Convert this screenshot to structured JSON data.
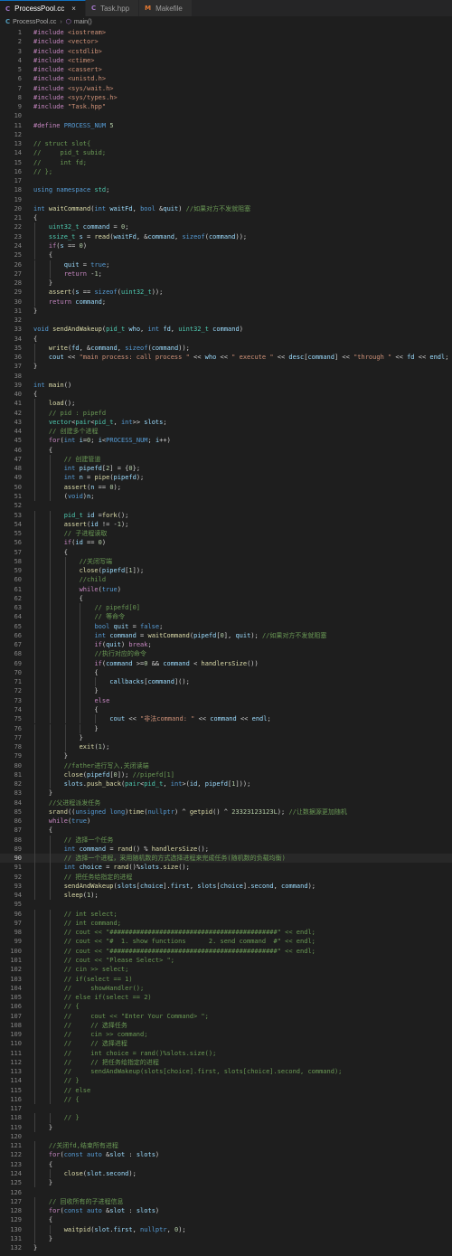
{
  "tabs": [
    {
      "label": "ProcessPool.cc",
      "icon": "C",
      "active": true
    },
    {
      "label": "Task.hpp",
      "icon": "C",
      "active": false
    },
    {
      "label": "Makefile",
      "icon": "M",
      "active": false
    }
  ],
  "breadcrumb": {
    "file": "ProcessPool.cc",
    "symbol": "main()"
  },
  "current_line": 90,
  "colors": {
    "accent": "#0e70c0",
    "background": "#1e1e1e",
    "keyword": "#569cd6",
    "string": "#ce9178",
    "comment": "#6a9955",
    "function": "#dcdcaa",
    "type": "#4ec9b0"
  },
  "code_lines": [
    "#include <iostream>",
    "#include <vector>",
    "#include <cstdlib>",
    "#include <ctime>",
    "#include <cassert>",
    "#include <unistd.h>",
    "#include <sys/wait.h>",
    "#include <sys/types.h>",
    "#include \"Task.hpp\"",
    "",
    "#define PROCESS_NUM 5",
    "",
    "// struct slot{",
    "//     pid_t subid;",
    "//     int fd;",
    "// };",
    "",
    "using namespace std;",
    "",
    "int waitCommand(int waitFd, bool &quit) //如果对方不发就阻塞",
    "{",
    "    uint32_t command = 0;",
    "    ssize_t s = read(waitFd, &command, sizeof(command));",
    "    if(s == 0)",
    "    {",
    "        quit = true;",
    "        return -1;",
    "    }",
    "    assert(s == sizeof(uint32_t));",
    "    return command;",
    "}",
    "",
    "void sendAndWakeup(pid_t who, int fd, uint32_t command)",
    "{",
    "    write(fd, &command, sizeof(command));",
    "    cout << \"main process: call process \" << who << \" execute \" << desc[command] << \"through \" << fd << endl;",
    "}",
    "",
    "int main()",
    "{",
    "    load();",
    "    // pid : pipefd",
    "    vector<pair<pid_t, int>> slots;",
    "    // 创建多个进程",
    "    for(int i=0; i<PROCESS_NUM; i++)",
    "    {",
    "        // 创建管道",
    "        int pipefd[2] = {0};",
    "        int n = pipe(pipefd);",
    "        assert(n == 0);",
    "        (void)n;",
    "",
    "        pid_t id =fork();",
    "        assert(id != -1);",
    "        // 子进程读取",
    "        if(id == 0)",
    "        {",
    "            //关闭写端",
    "            close(pipefd[1]);",
    "            //child",
    "            while(true)",
    "            {",
    "                // pipefd[0]",
    "                // 等命令",
    "                bool quit = false;",
    "                int command = waitCommand(pipefd[0], quit); //如果对方不发就阻塞",
    "                if(quit) break;",
    "                //执行对应的命令",
    "                if(command >=0 && command < handlersSize())",
    "                {",
    "                    callbacks[command]();",
    "                }",
    "                else",
    "                {",
    "                    cout << \"非法command: \" << command << endl;",
    "                }",
    "            }",
    "            exit(1);",
    "        }",
    "        //father进行写入,关闭读端",
    "        close(pipefd[0]); //pipefd[1]",
    "        slots.push_back(pair<pid_t, int>(id, pipefd[1]));",
    "    }",
    "    //父进程派发任务",
    "    srand((unsigned long)time(nullptr) ^ getpid() ^ 23323123123L); //让数据源更加随机",
    "    while(true)",
    "    {",
    "        // 选择一个任务",
    "        int command = rand() % handlersSize();",
    "        // 选择一个进程，采用随机数的方式选择进程来完成任务(随机数的负载均衡)",
    "        int choice = rand()%slots.size();",
    "        // 把任务给指定的进程",
    "        sendAndWakeup(slots[choice].first, slots[choice].second, command);",
    "        sleep(1);",
    "",
    "        // int select;",
    "        // int command;",
    "        // cout << \"############################################\" << endl;",
    "        // cout << \"#  1. show functions      2. send command  #\" << endl;",
    "        // cout << \"############################################\" << endl;",
    "        // cout << \"Please Select> \";",
    "        // cin >> select;",
    "        // if(select == 1)",
    "        //     showHandler();",
    "        // else if(select == 2)",
    "        // {",
    "        //     cout << \"Enter Your Command> \";",
    "        //     // 选择任务",
    "        //     cin >> command;",
    "        //     // 选择进程",
    "        //     int choice = rand()%slots.size();",
    "        //     // 把任务给指定的进程",
    "        //     sendAndWakeup(slots[choice].first, slots[choice].second, command);",
    "        // }",
    "        // else",
    "        // {",
    "",
    "        // }",
    "    }",
    "",
    "    //关闭fd,结束所有进程",
    "    for(const auto &slot : slots)",
    "    {",
    "        close(slot.second);",
    "    }",
    "",
    "    // 回收所有的子进程信息",
    "    for(const auto &slot : slots)",
    "    {",
    "        waitpid(slot.first, nullptr, 0);",
    "    }",
    "}"
  ]
}
